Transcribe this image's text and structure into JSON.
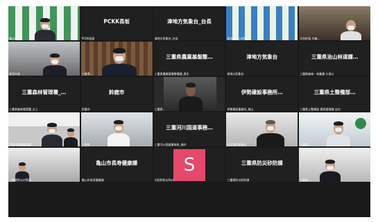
{
  "tiles": [
    {
      "name": "亀山市",
      "display": "",
      "video": true
    },
    {
      "name": "PCKK長坂",
      "display": "PCKK長坂",
      "video": false
    },
    {
      "name": "津地方気象台_台長",
      "display": "津地方気象台_台長",
      "video": false
    },
    {
      "name": "鳥羽市…上村防…",
      "display": "",
      "video": true
    },
    {
      "name": "大台町長 大森…",
      "display": "",
      "video": true
    },
    {
      "name": "鳥羽市長 …",
      "display": "",
      "video": true
    },
    {
      "name": "三重県…",
      "display": "",
      "video": true
    },
    {
      "name": "三重県農業基盤整備課_鳥生",
      "display": "三重県農業基盤整…",
      "video": false
    },
    {
      "name": "津地方気象台",
      "display": "津地方気象台",
      "video": false
    },
    {
      "name": "三重県森林・林業課 久保川",
      "display": "三重県治山林道課…",
      "video": false
    },
    {
      "name": "三重県森林管理署_丸上",
      "display": "三重森林管理署_…",
      "video": false
    },
    {
      "name": "鈴鹿市",
      "display": "鈴鹿市",
      "video": false
    },
    {
      "name": "三重県…",
      "display": "",
      "video": true
    },
    {
      "name": "伊勢建設事務所_堀山",
      "display": "伊勢建設事務所…",
      "video": false
    },
    {
      "name": "三重県土整備部 建設管理課 吉村",
      "display": "三重県土整備部…",
      "video": false
    },
    {
      "name": "伊賀市危機管理課",
      "display": "",
      "video": true
    },
    {
      "name": "三重県…",
      "display": "",
      "video": true
    },
    {
      "name": "三重河川国道事務所_鳴井",
      "display": "三重河川国道事務…",
      "video": false
    },
    {
      "name": "松阪建設事務所",
      "display": "",
      "video": true
    },
    {
      "name": "三重県…",
      "display": "",
      "video": true
    },
    {
      "name": "三重県防災対策部",
      "display": "",
      "video": true
    },
    {
      "name": "亀山市長寿健康課",
      "display": "亀山市長寿健康課",
      "video": false
    },
    {
      "name": "大紀町防災Pad…",
      "display": "",
      "video": false,
      "avatar": "S"
    },
    {
      "name": "三重県防災砂防課",
      "display": "三重県防災砂防課",
      "video": false
    },
    {
      "name": "三重県…",
      "display": "",
      "video": true
    }
  ],
  "colors": {
    "tile_bg": "#202020",
    "avatar": "#e4486a",
    "grid_bg": "#1a1a1a"
  }
}
